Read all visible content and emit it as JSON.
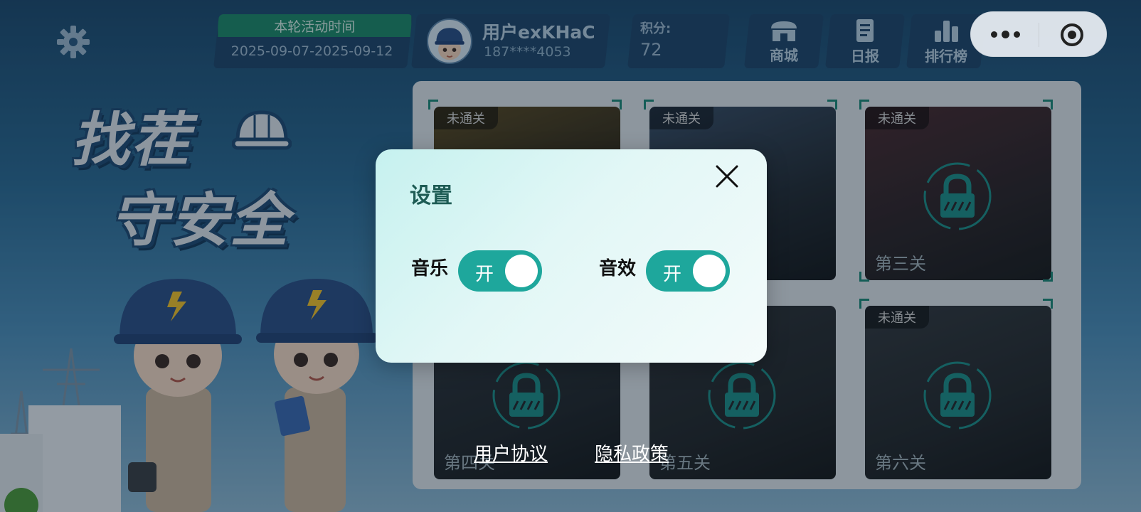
{
  "header": {
    "activity_title": "本轮活动时间",
    "activity_dates": "2025-09-07-2025-09-12",
    "user_name": "用户exKHaC",
    "user_phone": "187****4053",
    "points_label": "积分:",
    "points_value": "72",
    "nav": [
      {
        "label": "商城",
        "icon": "shop-icon"
      },
      {
        "label": "日报",
        "icon": "report-icon"
      },
      {
        "label": "排行榜",
        "icon": "ranking-icon"
      }
    ]
  },
  "title": {
    "line1": "找茬",
    "line2": "守安全"
  },
  "levels": [
    {
      "status": "未通关",
      "name": "",
      "locked": false
    },
    {
      "status": "未通关",
      "name": "",
      "locked": true
    },
    {
      "status": "未通关",
      "name": "第三关",
      "locked": true
    },
    {
      "status": "",
      "name": "第四关",
      "locked": true
    },
    {
      "status": "",
      "name": "第五关",
      "locked": true
    },
    {
      "status": "未通关",
      "name": "第六关",
      "locked": true
    }
  ],
  "links": {
    "user_agreement": "用户协议",
    "privacy_policy": "隐私政策"
  },
  "settings_dialog": {
    "title": "设置",
    "music_label": "音乐",
    "music_state": "开",
    "sound_label": "音效",
    "sound_state": "开"
  },
  "colors": {
    "accent": "#1ea79c",
    "header_card": "#20466b",
    "activity_head": "#1d8a6a"
  }
}
